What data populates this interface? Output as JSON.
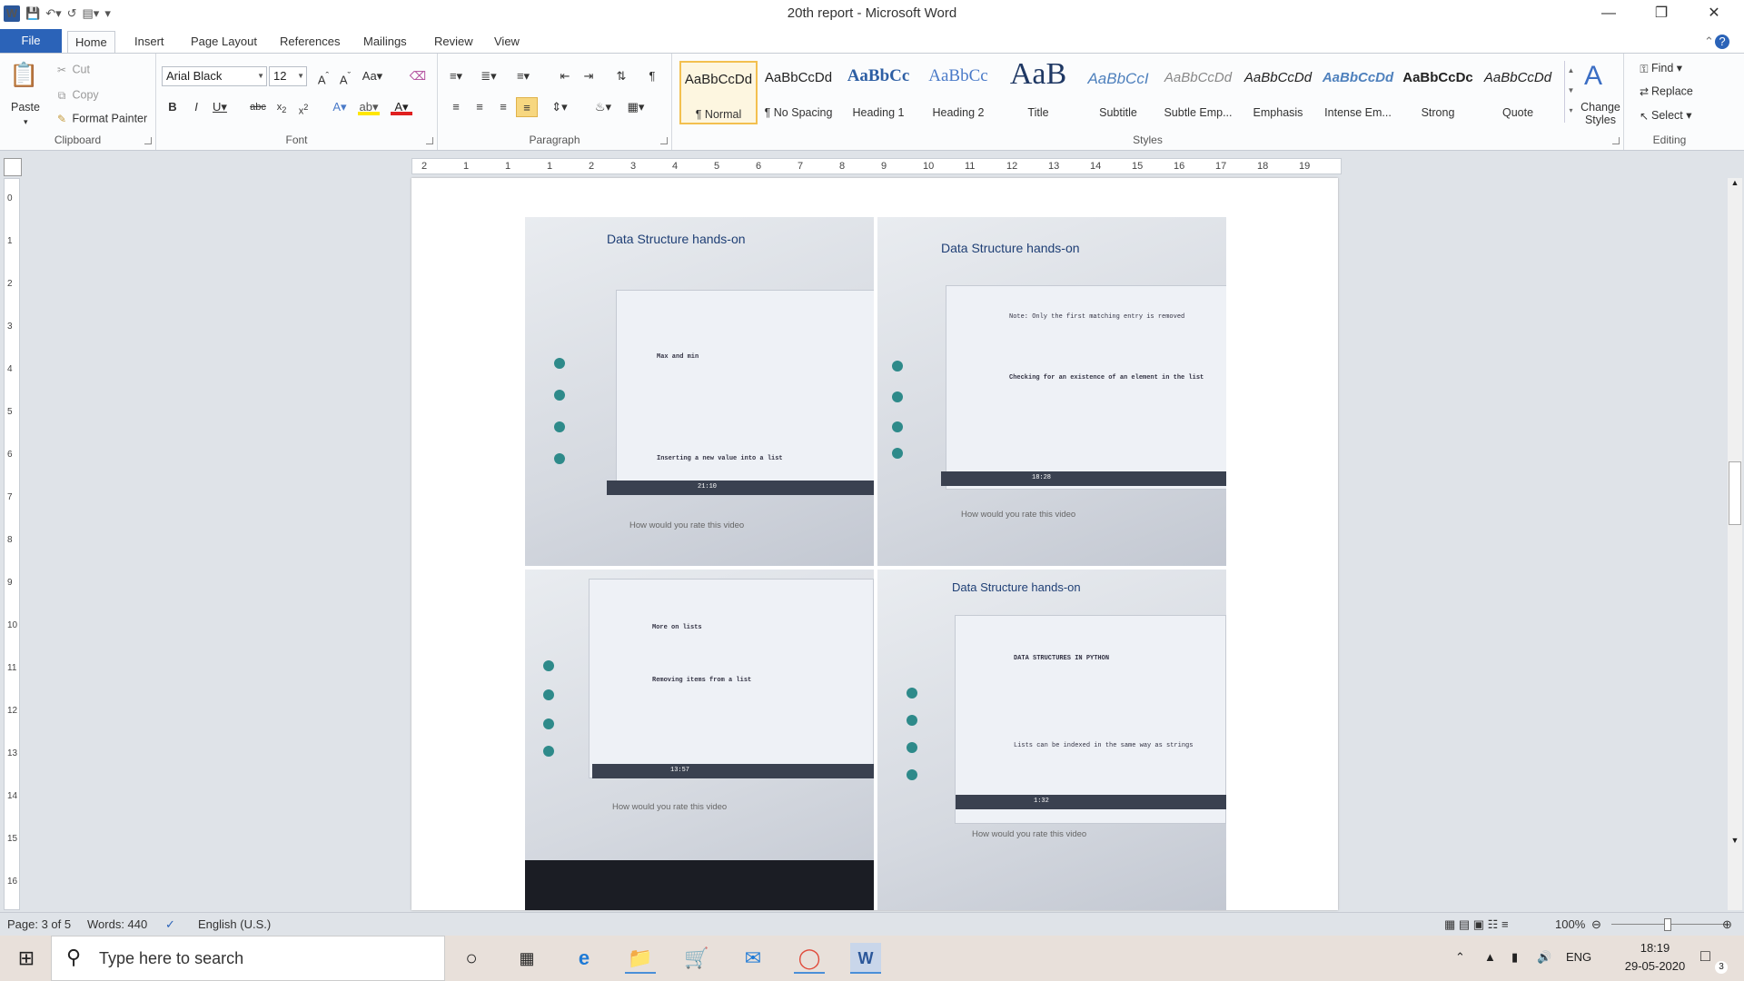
{
  "window": {
    "title": "20th report  -  Microsoft Word",
    "app_icon": "word-icon"
  },
  "quick_access": [
    "save-icon",
    "undo-icon",
    "redo-icon",
    "print-preview-icon",
    "customize-icon"
  ],
  "tabs": [
    "File",
    "Home",
    "Insert",
    "Page Layout",
    "References",
    "Mailings",
    "Review",
    "View"
  ],
  "active_tab": "Home",
  "clipboard": {
    "paste": "Paste",
    "cut": "Cut",
    "copy": "Copy",
    "format_painter": "Format Painter",
    "label": "Clipboard"
  },
  "font": {
    "name": "Arial Black",
    "size": "12",
    "label": "Font"
  },
  "paragraph": {
    "label": "Paragraph"
  },
  "styles": {
    "label": "Styles",
    "items": [
      {
        "preview": "AaBbCcDd",
        "name": "¶ Normal"
      },
      {
        "preview": "AaBbCcDd",
        "name": "¶ No Spacing"
      },
      {
        "preview": "AaBbCc",
        "name": "Heading 1"
      },
      {
        "preview": "AaBbCc",
        "name": "Heading 2"
      },
      {
        "preview": "AaB",
        "name": "Title"
      },
      {
        "preview": "AaBbCcI",
        "name": "Subtitle"
      },
      {
        "preview": "AaBbCcDd",
        "name": "Subtle Emp..."
      },
      {
        "preview": "AaBbCcDd",
        "name": "Emphasis"
      },
      {
        "preview": "AaBbCcDd",
        "name": "Intense Em..."
      },
      {
        "preview": "AaBbCcDc",
        "name": "Strong"
      },
      {
        "preview": "AaBbCcDd",
        "name": "Quote"
      }
    ],
    "change_styles": "Change Styles"
  },
  "editing": {
    "find": "Find",
    "replace": "Replace",
    "select": "Select",
    "label": "Editing"
  },
  "ruler": {
    "marks": [
      "2",
      "1",
      "1",
      "1",
      "2",
      "3",
      "4",
      "5",
      "6",
      "7",
      "8",
      "9",
      "10",
      "11",
      "12",
      "13",
      "14",
      "15",
      "16",
      "17",
      "18",
      "19"
    ]
  },
  "photos": [
    {
      "title": "Data Structure hands-on",
      "rate": "How would you rate this video",
      "heading1": "Max and min",
      "heading2": "Inserting a new value into a list",
      "time": "21:10"
    },
    {
      "title": "Data Structure hands-on",
      "rate": "How would you rate this video",
      "heading1": "Checking for an existence of an element in the list",
      "heading2": "Note: Only the first matching entry is removed",
      "time": "18:28"
    },
    {
      "title": "",
      "rate": "How would you rate this video",
      "heading1": "More on lists",
      "heading2": "Removing items from a list",
      "time": "13:57"
    },
    {
      "title": "Data Structure hands-on",
      "rate": "How would you rate this video",
      "heading1": "DATA STRUCTURES IN PYTHON",
      "heading2": "Lists can be indexed in the same way as strings",
      "time": "1:32"
    }
  ],
  "status": {
    "page": "Page: 3 of 5",
    "words": "Words: 440",
    "language": "English (U.S.)",
    "zoom": "100%"
  },
  "taskbar": {
    "search_placeholder": "Type here to search",
    "time": "18:19",
    "date": "29-05-2020",
    "lang": "ENG",
    "notifications": "3"
  }
}
